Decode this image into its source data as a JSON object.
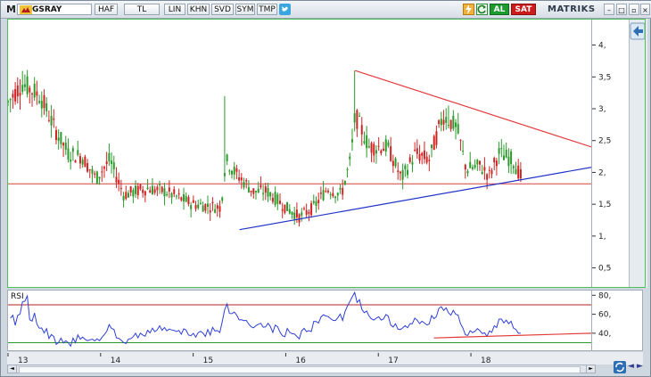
{
  "toolbar": {
    "logo": "M",
    "symbol": "GSRAY",
    "buttons": [
      "HAF",
      "TL",
      "LIN",
      "KHN",
      "SVD",
      "SYM",
      "TMP"
    ],
    "buy_label": "AL",
    "sell_label": "SAT",
    "brand": "MATRIKS"
  },
  "price_axis": {
    "ticks": [
      {
        "v": 4,
        "label": "4,"
      },
      {
        "v": 3.5,
        "label": "3,5"
      },
      {
        "v": 3,
        "label": "3,"
      },
      {
        "v": 2.5,
        "label": "2,5"
      },
      {
        "v": 2,
        "label": "2,"
      },
      {
        "v": 1.5,
        "label": "1,5"
      },
      {
        "v": 1,
        "label": "1,"
      },
      {
        "v": 0.5,
        "label": "0,5"
      }
    ]
  },
  "rsi": {
    "label": "RSI",
    "ticks": [
      {
        "v": 80,
        "label": "80,"
      },
      {
        "v": 60,
        "label": "60,"
      },
      {
        "v": 40,
        "label": "40,"
      }
    ],
    "upper_level": 70,
    "lower_level": 30
  },
  "x_axis": {
    "labels": [
      "13",
      "14",
      "15",
      "16",
      "17",
      "18"
    ]
  },
  "chart_data": {
    "type": "candlestick",
    "title": "",
    "ylim": [
      0.2,
      4.4
    ],
    "x_range": [
      13,
      19.3
    ],
    "support_line": 1.82,
    "trendlines": [
      {
        "color": "#e23b3b",
        "from": [
          16.75,
          3.6
        ],
        "to": [
          19.3,
          2.4
        ]
      },
      {
        "color": "#2133c9",
        "from": [
          15.5,
          1.1
        ],
        "to": [
          19.3,
          2.08
        ]
      }
    ],
    "rsi_trendline": {
      "color": "#e23b3b",
      "from": [
        17.6,
        35
      ],
      "to": [
        19.3,
        40
      ]
    },
    "key_closes": [
      {
        "x": 13.0,
        "y": 3.1
      },
      {
        "x": 13.15,
        "y": 3.4
      },
      {
        "x": 13.35,
        "y": 3.2
      },
      {
        "x": 13.5,
        "y": 2.7
      },
      {
        "x": 13.65,
        "y": 2.3
      },
      {
        "x": 13.8,
        "y": 2.25
      },
      {
        "x": 13.95,
        "y": 1.9
      },
      {
        "x": 14.1,
        "y": 2.2
      },
      {
        "x": 14.25,
        "y": 1.65
      },
      {
        "x": 14.5,
        "y": 1.75
      },
      {
        "x": 14.7,
        "y": 1.7
      },
      {
        "x": 15.0,
        "y": 1.5
      },
      {
        "x": 15.3,
        "y": 1.45
      },
      {
        "x": 15.35,
        "y": 2.2
      },
      {
        "x": 15.45,
        "y": 2.0
      },
      {
        "x": 15.65,
        "y": 1.7
      },
      {
        "x": 15.8,
        "y": 1.7
      },
      {
        "x": 16.0,
        "y": 1.45
      },
      {
        "x": 16.15,
        "y": 1.3
      },
      {
        "x": 16.3,
        "y": 1.45
      },
      {
        "x": 16.45,
        "y": 1.75
      },
      {
        "x": 16.6,
        "y": 1.65
      },
      {
        "x": 16.7,
        "y": 2.2
      },
      {
        "x": 16.75,
        "y": 2.9
      },
      {
        "x": 16.9,
        "y": 2.4
      },
      {
        "x": 17.1,
        "y": 2.4
      },
      {
        "x": 17.25,
        "y": 1.9
      },
      {
        "x": 17.4,
        "y": 2.3
      },
      {
        "x": 17.55,
        "y": 2.2
      },
      {
        "x": 17.7,
        "y": 2.9
      },
      {
        "x": 17.85,
        "y": 2.7
      },
      {
        "x": 17.95,
        "y": 2.05
      },
      {
        "x": 18.1,
        "y": 2.1
      },
      {
        "x": 18.2,
        "y": 1.95
      },
      {
        "x": 18.3,
        "y": 2.3
      },
      {
        "x": 18.45,
        "y": 2.2
      },
      {
        "x": 18.55,
        "y": 1.9
      }
    ]
  },
  "colors": {
    "up": "#2c9a2c",
    "down": "#d22323",
    "rsi_line": "#2f3fd6",
    "rsi_upper": "#b52121",
    "rsi_lower": "#2b9a2b"
  }
}
